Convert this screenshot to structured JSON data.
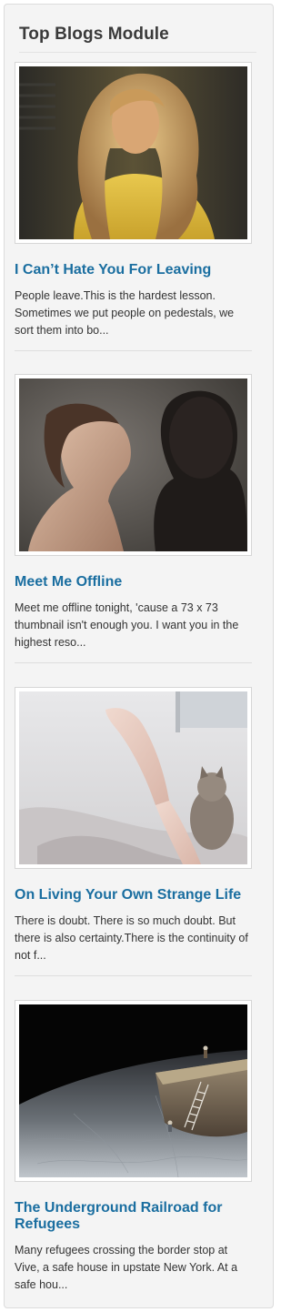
{
  "module": {
    "title": "Top Blogs Module",
    "posts": [
      {
        "title": "I Can’t Hate You For Leaving",
        "excerpt": "People leave.This is the hardest lesson. Sometimes we put people on pedestals, we sort them into bo...",
        "image": "woman-with-wavy-hair-photo"
      },
      {
        "title": "Meet Me Offline",
        "excerpt": "Meet me offline tonight, 'cause a 73 x 73 thumbnail isn't enough you. I want you in the highest reso...",
        "image": "couple-portrait-photo"
      },
      {
        "title": "On Living Your Own Strange Life",
        "excerpt": "There is doubt. There is so much doubt. But there is also certainty.There is the continuity of not f...",
        "image": "legs-with-cat-on-bed-photo"
      },
      {
        "title": "The Underground Railroad for Refugees",
        "excerpt": "Many refugees crossing the border stop at Vive, a safe house in upstate New York. At a safe hou...",
        "image": "miniature-figures-on-map-photo"
      }
    ]
  }
}
